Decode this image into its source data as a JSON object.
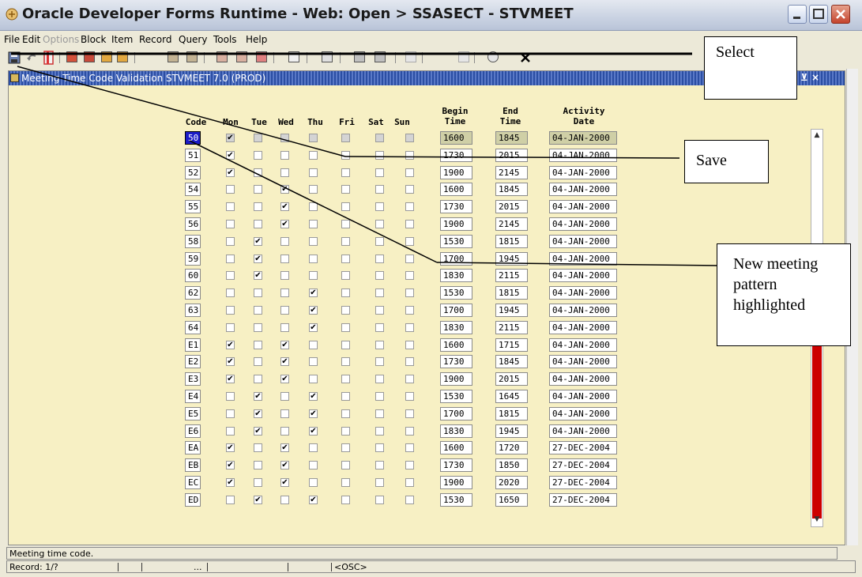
{
  "window": {
    "title": "Oracle Developer Forms Runtime - Web:  Open > SSASECT - STVMEET"
  },
  "menu": [
    "File",
    "Edit",
    "Options",
    "Block",
    "Item",
    "Record",
    "Query",
    "Tools",
    "Help"
  ],
  "form": {
    "title": "Meeting Time Code Validation  STVMEET  7.0  (PROD)",
    "headers": {
      "code": "Code",
      "mon": "Mon",
      "tue": "Tue",
      "wed": "Wed",
      "thu": "Thu",
      "fri": "Fri",
      "sat": "Sat",
      "sun": "Sun",
      "begin": "Begin\nTime",
      "end": "End\nTime",
      "activity": "Activity\nDate"
    },
    "rows": [
      {
        "code": "50",
        "days": [
          1,
          0,
          0,
          0,
          0,
          0,
          0
        ],
        "begin": "1600",
        "end": "1845",
        "date": "04-JAN-2000"
      },
      {
        "code": "51",
        "days": [
          1,
          0,
          0,
          0,
          0,
          0,
          0
        ],
        "begin": "1730",
        "end": "2015",
        "date": "04-JAN-2000"
      },
      {
        "code": "52",
        "days": [
          1,
          0,
          0,
          0,
          0,
          0,
          0
        ],
        "begin": "1900",
        "end": "2145",
        "date": "04-JAN-2000"
      },
      {
        "code": "54",
        "days": [
          0,
          0,
          1,
          0,
          0,
          0,
          0
        ],
        "begin": "1600",
        "end": "1845",
        "date": "04-JAN-2000"
      },
      {
        "code": "55",
        "days": [
          0,
          0,
          1,
          0,
          0,
          0,
          0
        ],
        "begin": "1730",
        "end": "2015",
        "date": "04-JAN-2000"
      },
      {
        "code": "56",
        "days": [
          0,
          0,
          1,
          0,
          0,
          0,
          0
        ],
        "begin": "1900",
        "end": "2145",
        "date": "04-JAN-2000"
      },
      {
        "code": "58",
        "days": [
          0,
          1,
          0,
          0,
          0,
          0,
          0
        ],
        "begin": "1530",
        "end": "1815",
        "date": "04-JAN-2000"
      },
      {
        "code": "59",
        "days": [
          0,
          1,
          0,
          0,
          0,
          0,
          0
        ],
        "begin": "1700",
        "end": "1945",
        "date": "04-JAN-2000"
      },
      {
        "code": "60",
        "days": [
          0,
          1,
          0,
          0,
          0,
          0,
          0
        ],
        "begin": "1830",
        "end": "2115",
        "date": "04-JAN-2000"
      },
      {
        "code": "62",
        "days": [
          0,
          0,
          0,
          1,
          0,
          0,
          0
        ],
        "begin": "1530",
        "end": "1815",
        "date": "04-JAN-2000"
      },
      {
        "code": "63",
        "days": [
          0,
          0,
          0,
          1,
          0,
          0,
          0
        ],
        "begin": "1700",
        "end": "1945",
        "date": "04-JAN-2000"
      },
      {
        "code": "64",
        "days": [
          0,
          0,
          0,
          1,
          0,
          0,
          0
        ],
        "begin": "1830",
        "end": "2115",
        "date": "04-JAN-2000"
      },
      {
        "code": "E1",
        "days": [
          1,
          0,
          1,
          0,
          0,
          0,
          0
        ],
        "begin": "1600",
        "end": "1715",
        "date": "04-JAN-2000"
      },
      {
        "code": "E2",
        "days": [
          1,
          0,
          1,
          0,
          0,
          0,
          0
        ],
        "begin": "1730",
        "end": "1845",
        "date": "04-JAN-2000"
      },
      {
        "code": "E3",
        "days": [
          1,
          0,
          1,
          0,
          0,
          0,
          0
        ],
        "begin": "1900",
        "end": "2015",
        "date": "04-JAN-2000"
      },
      {
        "code": "E4",
        "days": [
          0,
          1,
          0,
          1,
          0,
          0,
          0
        ],
        "begin": "1530",
        "end": "1645",
        "date": "04-JAN-2000"
      },
      {
        "code": "E5",
        "days": [
          0,
          1,
          0,
          1,
          0,
          0,
          0
        ],
        "begin": "1700",
        "end": "1815",
        "date": "04-JAN-2000"
      },
      {
        "code": "E6",
        "days": [
          0,
          1,
          0,
          1,
          0,
          0,
          0
        ],
        "begin": "1830",
        "end": "1945",
        "date": "04-JAN-2000"
      },
      {
        "code": "EA",
        "days": [
          1,
          0,
          1,
          0,
          0,
          0,
          0
        ],
        "begin": "1600",
        "end": "1720",
        "date": "27-DEC-2004"
      },
      {
        "code": "EB",
        "days": [
          1,
          0,
          1,
          0,
          0,
          0,
          0
        ],
        "begin": "1730",
        "end": "1850",
        "date": "27-DEC-2004"
      },
      {
        "code": "EC",
        "days": [
          1,
          0,
          1,
          0,
          0,
          0,
          0
        ],
        "begin": "1900",
        "end": "2020",
        "date": "27-DEC-2004"
      },
      {
        "code": "ED",
        "days": [
          0,
          1,
          0,
          1,
          0,
          0,
          0
        ],
        "begin": "1530",
        "end": "1650",
        "date": "27-DEC-2004"
      }
    ],
    "selected_row": 0
  },
  "status": {
    "message": "Meeting time code.",
    "record": "Record: 1/?",
    "ellipsis": "...",
    "osc": "<OSC>"
  },
  "callouts": {
    "select": "Select",
    "save": "Save",
    "new_pattern": "New meeting pattern highlighted"
  },
  "icons": [
    "save-icon",
    "rollback-icon",
    "exit-icon",
    "x-icon"
  ],
  "colors": {
    "form_bg": "#f7f0c4",
    "selected_code_bg": "#1b1bc7",
    "scroll_thumb": "#cc0000",
    "title_stripe": "#2b4ea3"
  }
}
